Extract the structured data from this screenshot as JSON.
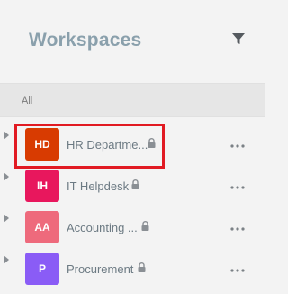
{
  "header": {
    "title": "Workspaces",
    "filter_icon": "filter-icon"
  },
  "section": {
    "label": "All"
  },
  "workspaces": [
    {
      "initials": "HD",
      "name": "HR Departme...",
      "color": "#d83b01",
      "locked": true
    },
    {
      "initials": "IH",
      "name": "IT Helpdesk",
      "color": "#e8175d",
      "locked": true
    },
    {
      "initials": "AA",
      "name": "Accounting ...",
      "color": "#ee6a7c",
      "locked": true
    },
    {
      "initials": "P",
      "name": "Procurement",
      "color": "#8a5cf6",
      "locked": true
    }
  ],
  "colors": {
    "title": "#8aa0ac",
    "highlight": "#e11a22",
    "background": "#f3f3f3",
    "section_bg": "#e6e6e6"
  }
}
